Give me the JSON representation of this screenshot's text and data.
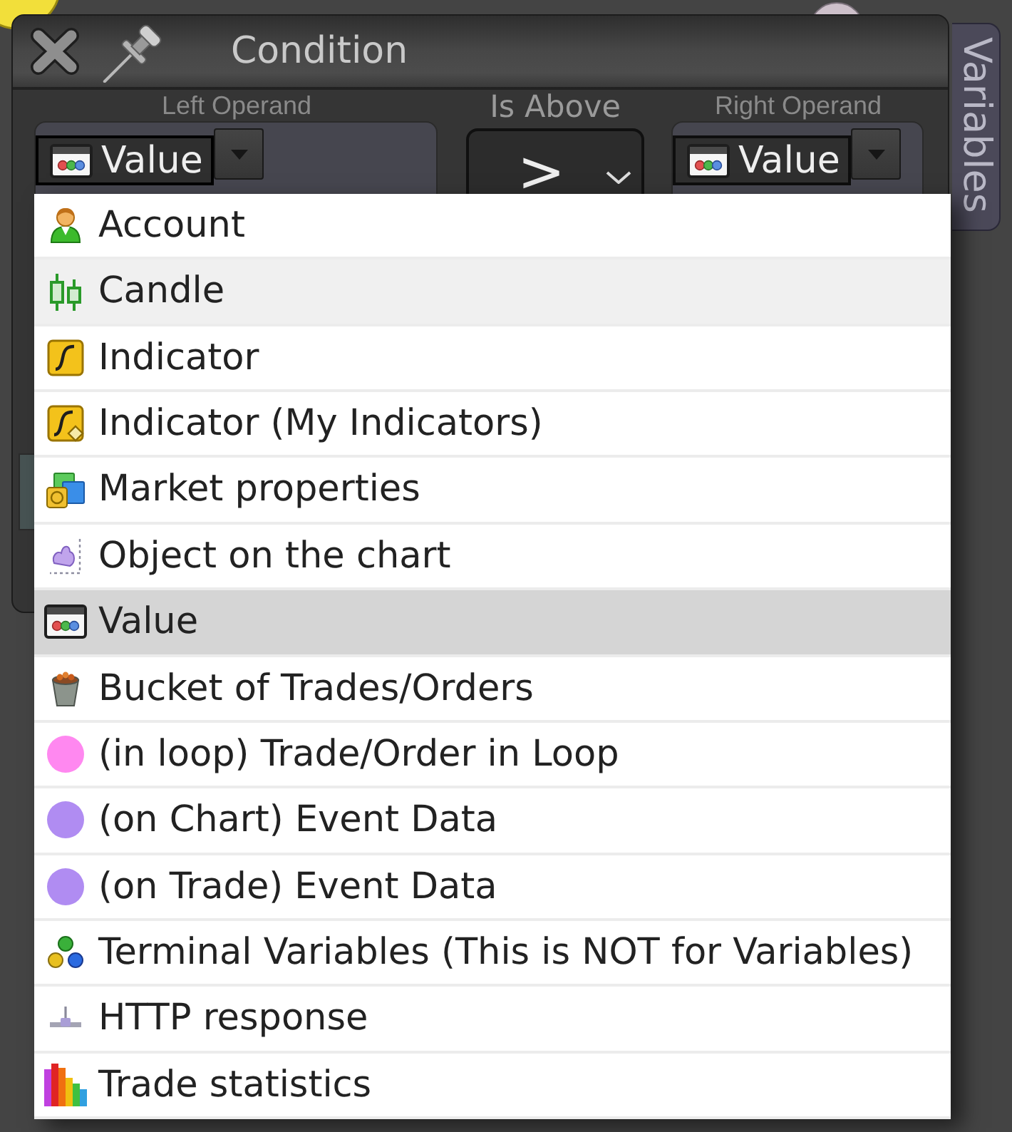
{
  "window": {
    "title": "Condition",
    "side_tab": "Variables"
  },
  "left_operand": {
    "label": "Left Operand",
    "value": "Value",
    "kind": "value",
    "expanded": true
  },
  "operator": {
    "label": "Is Above",
    "symbol": ">"
  },
  "right_operand": {
    "label": "Right Operand",
    "value": "Value",
    "kind": "value"
  },
  "menu": {
    "items": [
      {
        "label": "Account",
        "kind": "account",
        "hovered": false,
        "selected": false
      },
      {
        "label": "Candle",
        "kind": "candle",
        "hovered": true,
        "selected": false
      },
      {
        "label": "Indicator",
        "kind": "indicator",
        "hovered": false,
        "selected": false
      },
      {
        "label": "Indicator (My Indicators)",
        "kind": "my_indicator",
        "hovered": false,
        "selected": false
      },
      {
        "label": "Market properties",
        "kind": "market",
        "hovered": false,
        "selected": false
      },
      {
        "label": "Object on the chart",
        "kind": "chart_object",
        "hovered": false,
        "selected": false
      },
      {
        "label": "Value",
        "kind": "value",
        "hovered": false,
        "selected": true
      },
      {
        "label": "Bucket of Trades/Orders",
        "kind": "bucket",
        "hovered": false,
        "selected": false
      },
      {
        "label": "(in loop) Trade/Order in Loop",
        "kind": "dot",
        "color": "#ff88f0",
        "hovered": false,
        "selected": false
      },
      {
        "label": "(on Chart) Event Data",
        "kind": "dot",
        "color": "#b08cf2",
        "hovered": false,
        "selected": false
      },
      {
        "label": "(on Trade) Event Data",
        "kind": "dot",
        "color": "#b08cf2",
        "hovered": false,
        "selected": false
      },
      {
        "label": "Terminal Variables (This is NOT for Variables)",
        "kind": "terminal",
        "hovered": false,
        "selected": false
      },
      {
        "label": "HTTP response",
        "kind": "http",
        "hovered": false,
        "selected": false
      },
      {
        "label": "Trade statistics",
        "kind": "stats",
        "hovered": false,
        "selected": false
      }
    ]
  }
}
